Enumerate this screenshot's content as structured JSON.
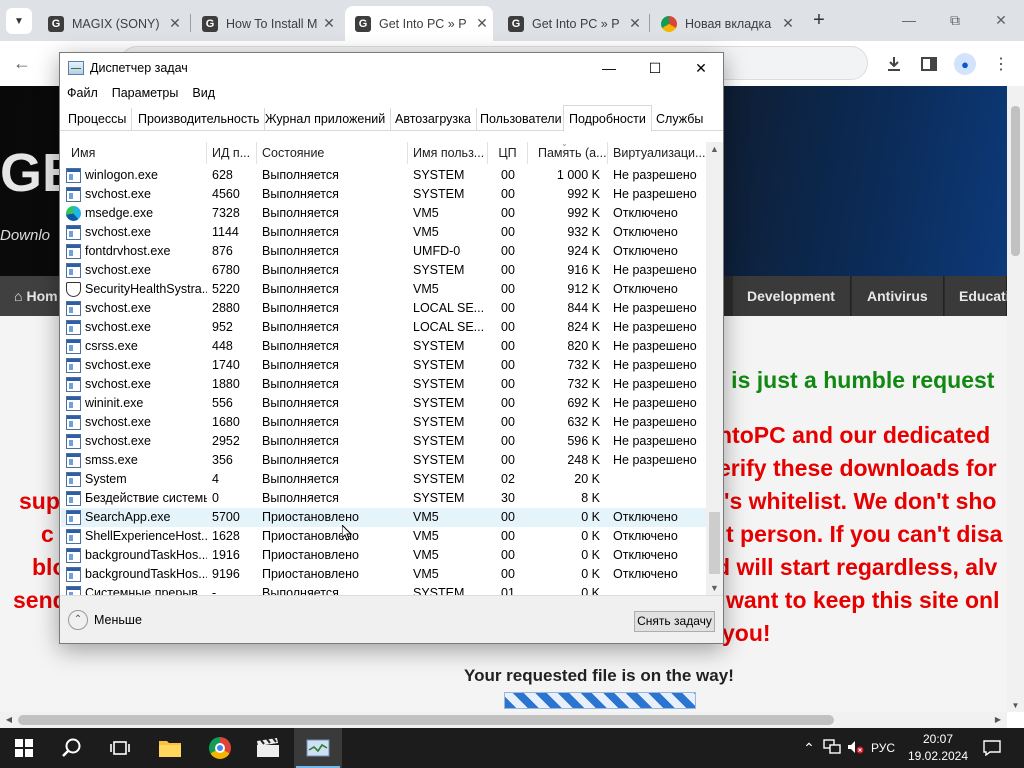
{
  "browser": {
    "tabs": [
      {
        "title": "MAGIX (SONY)",
        "favicon": "G",
        "active": false
      },
      {
        "title": "How To Install M",
        "favicon": "G",
        "active": false
      },
      {
        "title": "Get Into PC » P",
        "favicon": "G",
        "active": true
      },
      {
        "title": "Get Into PC » P",
        "favicon": "G",
        "active": false
      },
      {
        "title": "Новая вкладка",
        "favicon": "chrome",
        "active": false
      }
    ]
  },
  "webpage": {
    "logo": "GE",
    "subtitle": "Downlo",
    "nav": [
      "Hom",
      "Development",
      "Antivirus",
      "Educati"
    ],
    "lines": [
      "s is just a humble request",
      "ntoPC and our dedicated",
      "erify these downloads for",
      "supp",
      "'s whitelist. We don't sho",
      "c",
      "t person. If you can't disa",
      "blo",
      "d will start regardless, alv",
      "send",
      "want to keep this site onl",
      "you!"
    ],
    "requested": "Your requested file is on the way!"
  },
  "taskmanager": {
    "title": "Диспетчер задач",
    "menu": [
      "Файл",
      "Параметры",
      "Вид"
    ],
    "tabs": [
      "Процессы",
      "Производительность",
      "Журнал приложений",
      "Автозагрузка",
      "Пользователи",
      "Подробности",
      "Службы"
    ],
    "active_tab": "Подробности",
    "columns": [
      "Имя",
      "ИД п...",
      "Состояние",
      "Имя польз...",
      "ЦП",
      "Память (а...",
      "Виртуализаци..."
    ],
    "rows": [
      {
        "icon": "win",
        "name": "winlogon.exe",
        "pid": "628",
        "status": "Выполняется",
        "user": "SYSTEM",
        "cpu": "00",
        "mem": "1 000 K",
        "virt": "Не разрешено"
      },
      {
        "icon": "win",
        "name": "svchost.exe",
        "pid": "4560",
        "status": "Выполняется",
        "user": "SYSTEM",
        "cpu": "00",
        "mem": "992 K",
        "virt": "Не разрешено"
      },
      {
        "icon": "edge",
        "name": "msedge.exe",
        "pid": "7328",
        "status": "Выполняется",
        "user": "VM5",
        "cpu": "00",
        "mem": "992 K",
        "virt": "Отключено"
      },
      {
        "icon": "win",
        "name": "svchost.exe",
        "pid": "1144",
        "status": "Выполняется",
        "user": "VM5",
        "cpu": "00",
        "mem": "932 K",
        "virt": "Отключено"
      },
      {
        "icon": "win",
        "name": "fontdrvhost.exe",
        "pid": "876",
        "status": "Выполняется",
        "user": "UMFD-0",
        "cpu": "00",
        "mem": "924 K",
        "virt": "Отключено"
      },
      {
        "icon": "win",
        "name": "svchost.exe",
        "pid": "6780",
        "status": "Выполняется",
        "user": "SYSTEM",
        "cpu": "00",
        "mem": "916 K",
        "virt": "Не разрешено"
      },
      {
        "icon": "shield",
        "name": "SecurityHealthSystra...",
        "pid": "5220",
        "status": "Выполняется",
        "user": "VM5",
        "cpu": "00",
        "mem": "912 K",
        "virt": "Отключено"
      },
      {
        "icon": "win",
        "name": "svchost.exe",
        "pid": "2880",
        "status": "Выполняется",
        "user": "LOCAL SE...",
        "cpu": "00",
        "mem": "844 K",
        "virt": "Не разрешено"
      },
      {
        "icon": "win",
        "name": "svchost.exe",
        "pid": "952",
        "status": "Выполняется",
        "user": "LOCAL SE...",
        "cpu": "00",
        "mem": "824 K",
        "virt": "Не разрешено"
      },
      {
        "icon": "win",
        "name": "csrss.exe",
        "pid": "448",
        "status": "Выполняется",
        "user": "SYSTEM",
        "cpu": "00",
        "mem": "820 K",
        "virt": "Не разрешено"
      },
      {
        "icon": "win",
        "name": "svchost.exe",
        "pid": "1740",
        "status": "Выполняется",
        "user": "SYSTEM",
        "cpu": "00",
        "mem": "732 K",
        "virt": "Не разрешено"
      },
      {
        "icon": "win",
        "name": "svchost.exe",
        "pid": "1880",
        "status": "Выполняется",
        "user": "SYSTEM",
        "cpu": "00",
        "mem": "732 K",
        "virt": "Не разрешено"
      },
      {
        "icon": "win",
        "name": "wininit.exe",
        "pid": "556",
        "status": "Выполняется",
        "user": "SYSTEM",
        "cpu": "00",
        "mem": "692 K",
        "virt": "Не разрешено"
      },
      {
        "icon": "win",
        "name": "svchost.exe",
        "pid": "1680",
        "status": "Выполняется",
        "user": "SYSTEM",
        "cpu": "00",
        "mem": "632 K",
        "virt": "Не разрешено"
      },
      {
        "icon": "win",
        "name": "svchost.exe",
        "pid": "2952",
        "status": "Выполняется",
        "user": "SYSTEM",
        "cpu": "00",
        "mem": "596 K",
        "virt": "Не разрешено"
      },
      {
        "icon": "win",
        "name": "smss.exe",
        "pid": "356",
        "status": "Выполняется",
        "user": "SYSTEM",
        "cpu": "00",
        "mem": "248 K",
        "virt": "Не разрешено"
      },
      {
        "icon": "win",
        "name": "System",
        "pid": "4",
        "status": "Выполняется",
        "user": "SYSTEM",
        "cpu": "02",
        "mem": "20 K",
        "virt": ""
      },
      {
        "icon": "win",
        "name": "Бездействие системы",
        "pid": "0",
        "status": "Выполняется",
        "user": "SYSTEM",
        "cpu": "30",
        "mem": "8 K",
        "virt": ""
      },
      {
        "icon": "win",
        "name": "SearchApp.exe",
        "pid": "5700",
        "status": "Приостановлено",
        "user": "VM5",
        "cpu": "00",
        "mem": "0 K",
        "virt": "Отключено",
        "highlight": true
      },
      {
        "icon": "win",
        "name": "ShellExperienceHost...",
        "pid": "1628",
        "status": "Приостановлено",
        "user": "VM5",
        "cpu": "00",
        "mem": "0 K",
        "virt": "Отключено"
      },
      {
        "icon": "win",
        "name": "backgroundTaskHos...",
        "pid": "1916",
        "status": "Приостановлено",
        "user": "VM5",
        "cpu": "00",
        "mem": "0 K",
        "virt": "Отключено"
      },
      {
        "icon": "win",
        "name": "backgroundTaskHos...",
        "pid": "9196",
        "status": "Приостановлено",
        "user": "VM5",
        "cpu": "00",
        "mem": "0 K",
        "virt": "Отключено"
      },
      {
        "icon": "win",
        "name": "Системные прерыв...",
        "pid": "-",
        "status": "Выполняется",
        "user": "SYSTEM",
        "cpu": "01",
        "mem": "0 K",
        "virt": ""
      }
    ],
    "less_label": "Меньше",
    "end_task_label": "Снять задачу"
  },
  "taskbar": {
    "lang": "РУС",
    "time": "20:07",
    "date": "19.02.2024"
  }
}
